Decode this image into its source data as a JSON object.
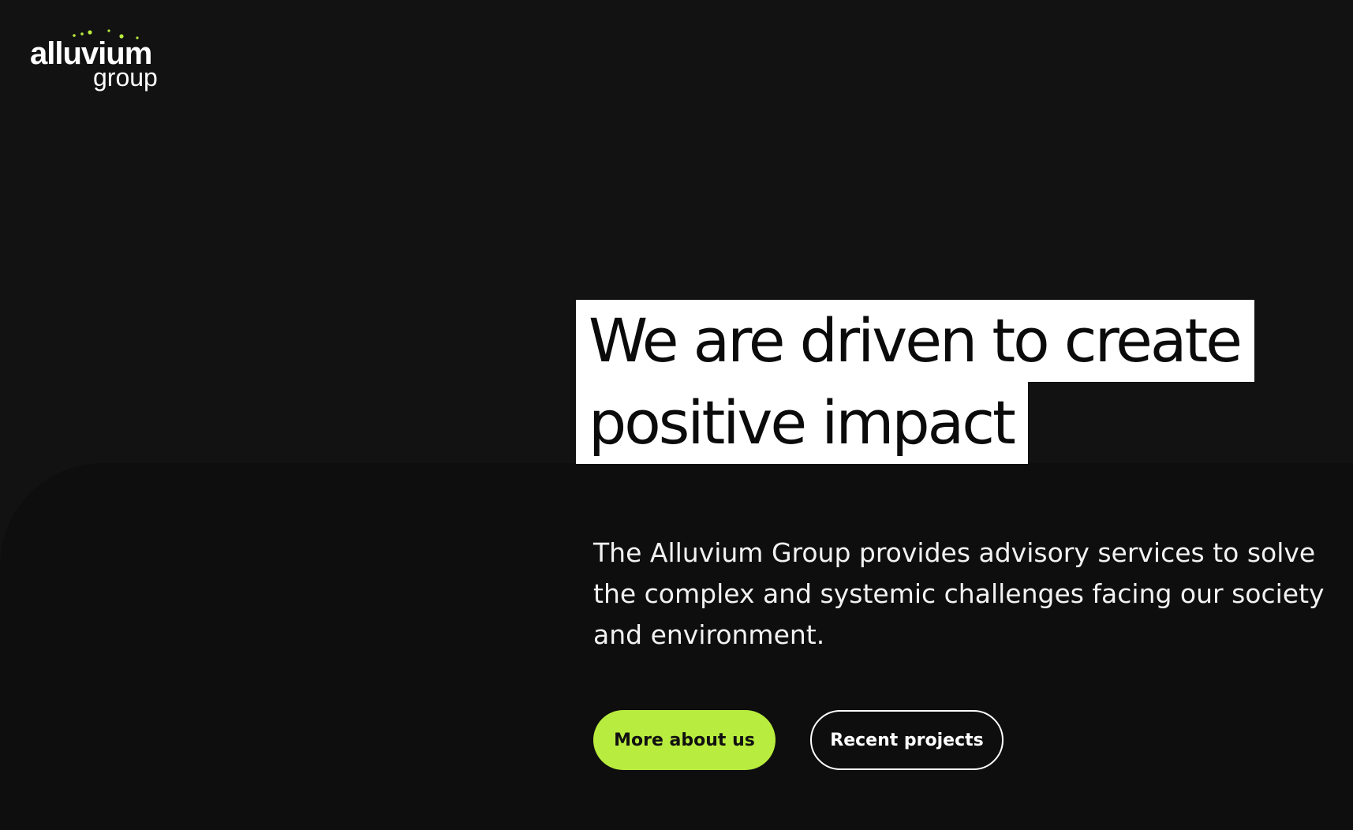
{
  "brand": {
    "wordmark": "alluvium",
    "wordmark_sub": "group",
    "accent_color": "#b8ec3e",
    "logo_icon": "dotted-arc-icon"
  },
  "hero": {
    "headline_line1": "We are driven to create",
    "headline_line2": "positive impact",
    "intro": "The Alluvium Group provides advisory services to solve the complex and systemic challenges facing our society and environment."
  },
  "actions": {
    "primary_label": "More about us",
    "secondary_label": "Recent projects"
  },
  "colors": {
    "background": "#121212",
    "panel": "#0e0e0e",
    "headline_highlight": "#ffffff",
    "headline_text": "#0b0b0b"
  }
}
